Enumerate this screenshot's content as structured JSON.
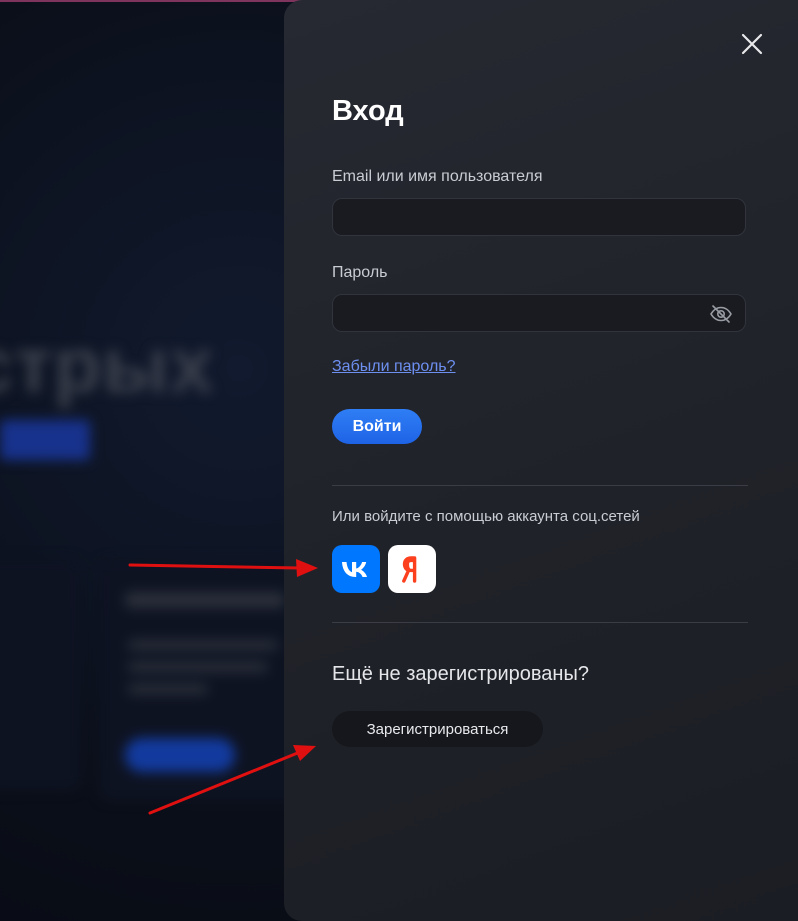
{
  "background": {
    "heading_fragment": "стрых"
  },
  "modal": {
    "title": "Вход",
    "close_icon": "close-icon",
    "email_label": "Email или имя пользователя",
    "email_value": "",
    "password_label": "Пароль",
    "password_value": "",
    "password_toggle_icon": "eye-off-icon",
    "forgot_link": "Забыли пароль?",
    "login_button": "Войти",
    "social_text": "Или войдите с помощью аккаунта соц.сетей",
    "social_buttons": [
      {
        "name": "vk",
        "icon": "vk-logo",
        "color": "#0077ff"
      },
      {
        "name": "yandex",
        "icon": "yandex-logo",
        "color": "#ffffff"
      }
    ],
    "register_heading": "Ещё не зарегистрированы?",
    "register_button": "Зарегистрироваться"
  },
  "colors": {
    "accent": "#1e63e6",
    "link": "#6d8ff0",
    "annotation_arrow": "#e01010"
  }
}
